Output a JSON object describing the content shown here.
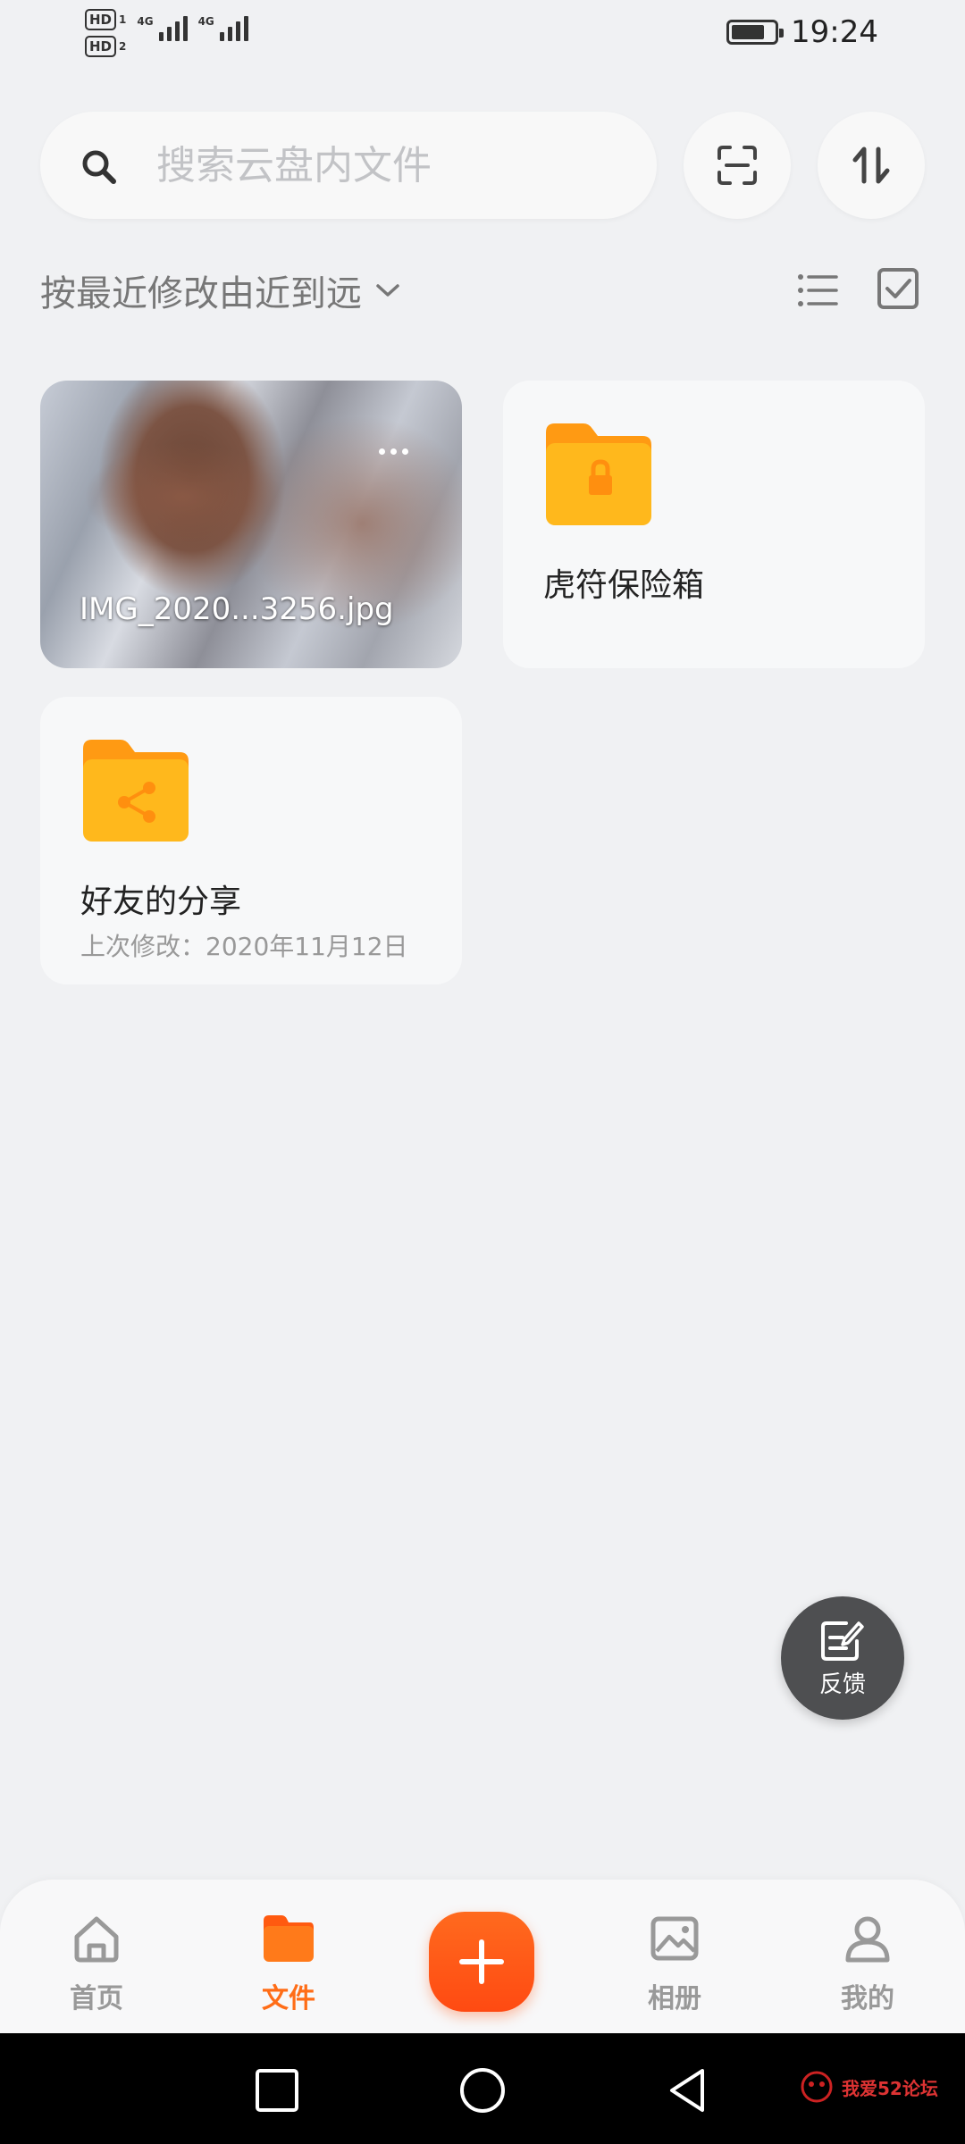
{
  "status_bar": {
    "sim1_label": "HD",
    "sim1_index": "1",
    "sim2_label": "HD",
    "sim2_index": "2",
    "net1": "4G",
    "net2": "4G",
    "battery_level": 0.78,
    "time": "19:24"
  },
  "search": {
    "placeholder": "搜索云盘内文件",
    "scan_icon": "scan-icon",
    "sort_icon": "transfer-icon"
  },
  "sort": {
    "label": "按最近修改由近到远",
    "list_view_icon": "list-view-icon",
    "select_icon": "checkbox-icon"
  },
  "files": [
    {
      "type": "image",
      "name": "IMG_2020...3256.jpg"
    },
    {
      "type": "folder",
      "name": "虎符保险箱",
      "icon": "lock-folder-icon"
    },
    {
      "type": "folder",
      "name": "好友的分享",
      "modified": "上次修改：2020年11月12日",
      "icon": "share-folder-icon"
    }
  ],
  "feedback": {
    "label": "反馈"
  },
  "tabbar": {
    "items": [
      {
        "label": "首页",
        "icon": "home-icon"
      },
      {
        "label": "文件",
        "icon": "folder-icon",
        "active": true
      },
      {
        "label": "",
        "icon": "plus-icon"
      },
      {
        "label": "相册",
        "icon": "album-icon"
      },
      {
        "label": "我的",
        "icon": "profile-icon"
      }
    ]
  },
  "colors": {
    "accent": "#ff6d17",
    "folder": "#ffb31a",
    "background": "#f0f1f3"
  },
  "watermark": {
    "text": "我爱52论坛"
  }
}
